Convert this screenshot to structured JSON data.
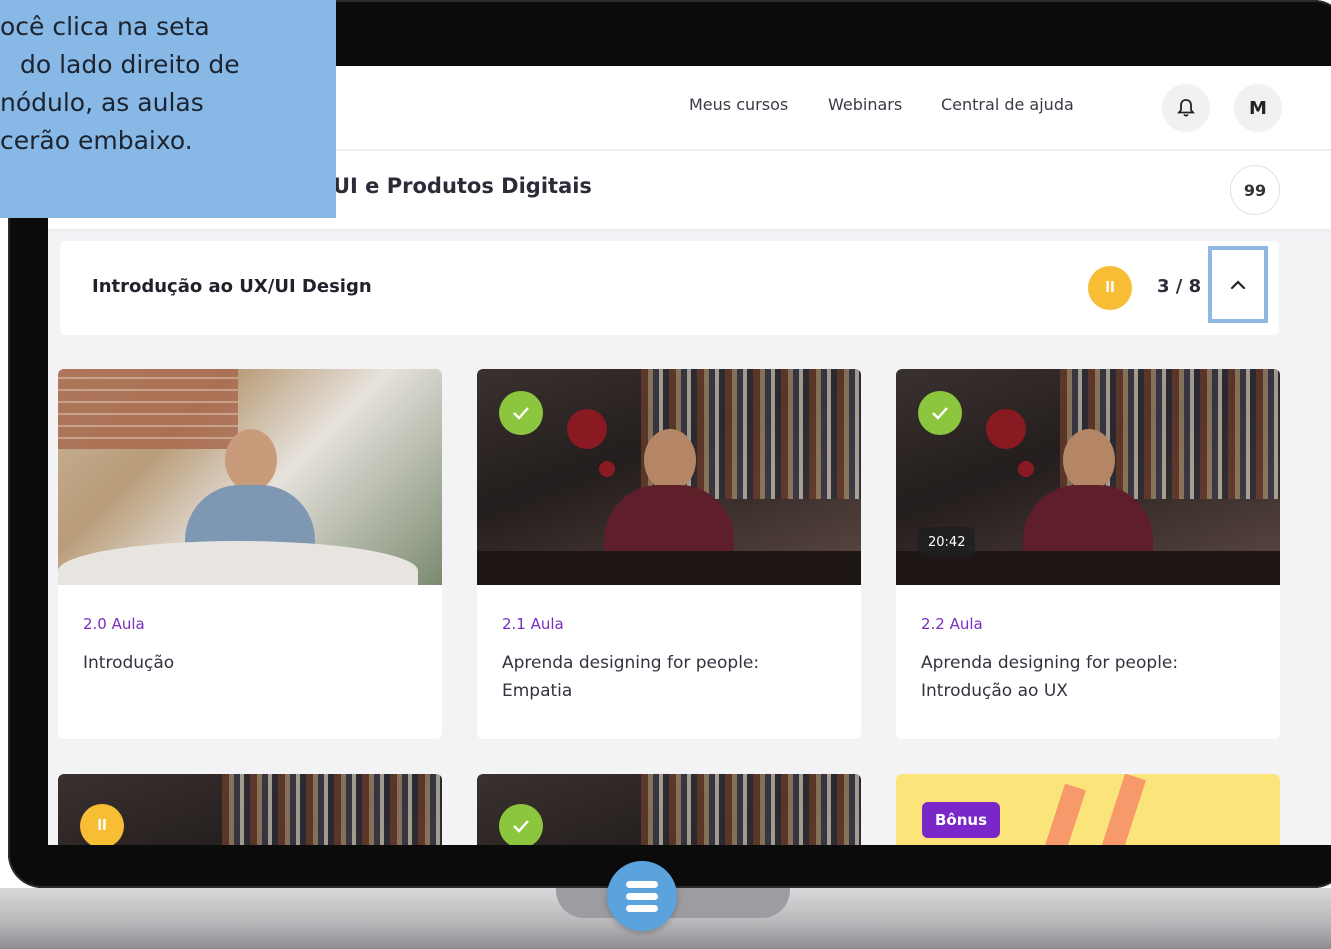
{
  "tooltip": {
    "lines": [
      "ocê clica na seta",
      "do lado direito de",
      "nódulo, as aulas",
      "cerão embaixo."
    ]
  },
  "nav": {
    "links": [
      "Meus cursos",
      "Webinars",
      "Central de ajuda"
    ],
    "bell_icon": "bell-icon",
    "avatar_initial": "M"
  },
  "course": {
    "title": "UI e Produtos Digitais",
    "quote_icon_text": "99"
  },
  "module": {
    "title": "Introdução ao UX/UI Design",
    "status_icon": "pause-icon",
    "progress": "3 / 8",
    "collapse_icon": "chevron-up-icon"
  },
  "lessons": [
    {
      "label": "2.0 Aula",
      "title": "Introdução",
      "status": "none",
      "duration": ""
    },
    {
      "label": "2.1 Aula",
      "title": "Aprenda designing for people: Empatia",
      "status": "completed",
      "duration": ""
    },
    {
      "label": "2.2 Aula",
      "title": "Aprenda designing for people: Introdução ao UX",
      "status": "completed",
      "duration": "20:42"
    }
  ],
  "next_row": {
    "bonus_label": "Bônus",
    "statuses": [
      "paused",
      "completed",
      "bonus"
    ]
  },
  "colors": {
    "accent_purple": "#7a2ec2",
    "completed_green": "#8cc63e",
    "paused_yellow": "#f7bd35",
    "highlight_blue": "#8fb9e3",
    "tooltip_bg": "#88b8e6"
  }
}
